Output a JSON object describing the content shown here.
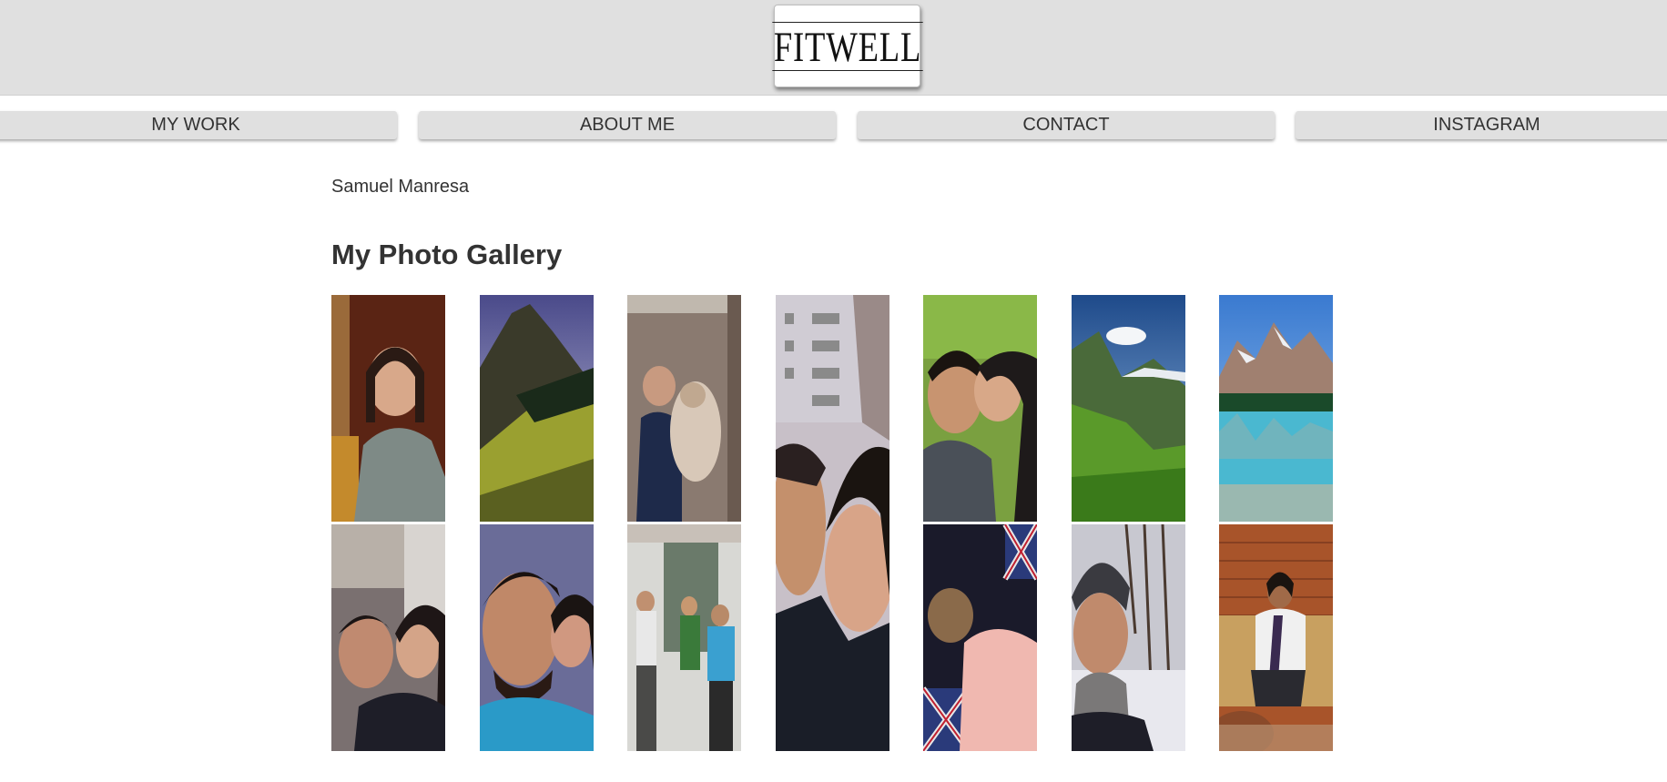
{
  "header": {
    "logo_text": "FITWELL"
  },
  "nav": {
    "items": [
      {
        "label": "MY WORK"
      },
      {
        "label": "ABOUT ME"
      },
      {
        "label": "CONTACT"
      },
      {
        "label": "INSTAGRAM"
      }
    ]
  },
  "main": {
    "author": "Samuel Manresa",
    "title": "My Photo Gallery"
  },
  "colors": {
    "header_bg": "#e0e0e0",
    "nav_button_bg": "#e0e0e0",
    "text": "#333333"
  }
}
